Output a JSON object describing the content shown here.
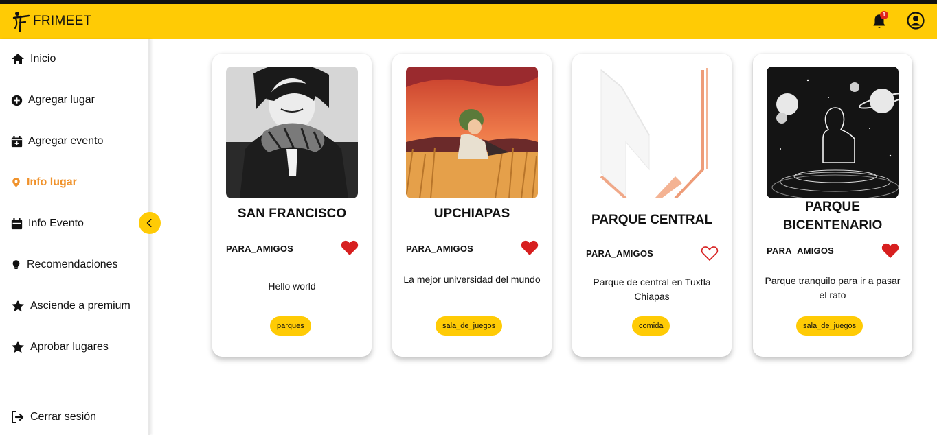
{
  "app": {
    "name": "FRIMEET",
    "notification_count": "1"
  },
  "colors": {
    "brand": "#ffcb05",
    "active": "#f0922b",
    "heart": "#d71f1f",
    "badge": "#e1251b"
  },
  "sidebar": {
    "items": [
      {
        "label": "Inicio",
        "icon": "home-icon"
      },
      {
        "label": "Agregar lugar",
        "icon": "plus-circle-icon"
      },
      {
        "label": "Agregar evento",
        "icon": "calendar-plus-icon"
      },
      {
        "label": "Info lugar",
        "icon": "location-pin-icon",
        "active": true
      },
      {
        "label": "Info Evento",
        "icon": "calendar-icon"
      },
      {
        "label": "Recomendaciones",
        "icon": "lightbulb-icon"
      },
      {
        "label": "Asciende a premium",
        "icon": "star-icon"
      },
      {
        "label": "Aprobar lugares",
        "icon": "star-icon"
      }
    ],
    "logout": {
      "label": "Cerrar sesión",
      "icon": "logout-icon"
    }
  },
  "cards": [
    {
      "title": "SAN FRANCISCO",
      "category": "PARA_AMIGOS",
      "favorite": true,
      "description": "Hello world",
      "tag": "parques",
      "image": "anime-boy-scarf-illustration"
    },
    {
      "title": "UPCHIAPAS",
      "category": "PARA_AMIGOS",
      "favorite": true,
      "description": "La mejor universidad del mundo",
      "tag": "sala_de_juegos",
      "image": "anime-wheat-field-sunset-illustration"
    },
    {
      "title": "PARQUE CENTRAL",
      "category": "PARA_AMIGOS",
      "favorite": false,
      "description": "Parque de central en Tuxtla Chiapas",
      "tag": "comida",
      "image": "geometric-w-logo"
    },
    {
      "title": "PARQUE BICENTENARIO",
      "category": "PARA_AMIGOS",
      "favorite": true,
      "description": "Parque tranquilo para ir a pasar el rato",
      "tag": "sala_de_juegos",
      "image": "space-planets-silhouette-illustration"
    }
  ]
}
